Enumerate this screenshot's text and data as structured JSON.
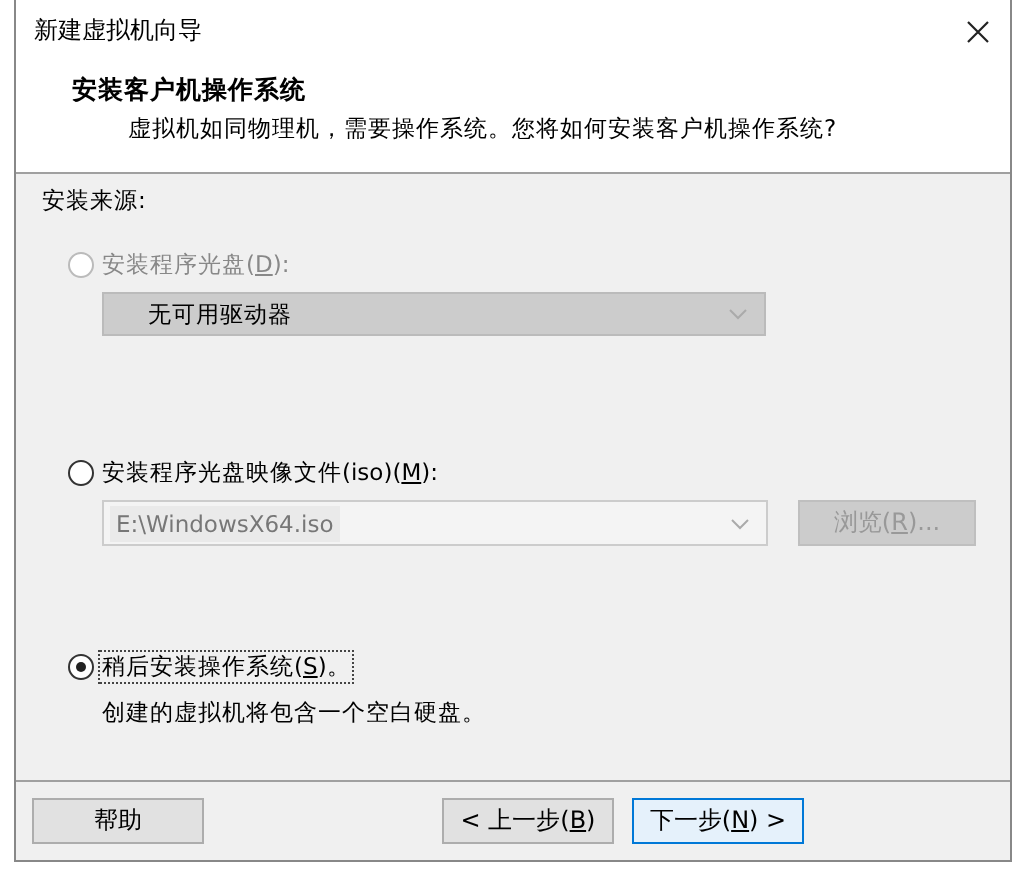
{
  "window": {
    "title": "新建虚拟机向导"
  },
  "header": {
    "title": "安装客户机操作系统",
    "subtitle": "虚拟机如同物理机，需要操作系统。您将如何安装客户机操作系统?"
  },
  "install_source": {
    "label": "安装来源:",
    "options": [
      {
        "kind": "drive",
        "before": "安装程序光盘(",
        "key": "D",
        "after": "):",
        "selected": false,
        "disabled": true,
        "focused": false,
        "select": {
          "value": "无可用驱动器",
          "disabled": true
        }
      },
      {
        "kind": "image",
        "before": "安装程序光盘映像文件(iso)(",
        "key": "M",
        "after": "):",
        "selected": false,
        "disabled": false,
        "focused": false,
        "combo": {
          "value": "E:\\WindowsX64.iso",
          "disabled": true
        },
        "browse": {
          "before": "浏览(",
          "key": "R",
          "after": ")...",
          "disabled": true
        }
      },
      {
        "kind": "later",
        "before": "稍后安装操作系统(",
        "key": "S",
        "after": ")。",
        "selected": true,
        "disabled": false,
        "focused": true,
        "description": "创建的虚拟机将包含一个空白硬盘。"
      }
    ]
  },
  "buttons": [
    {
      "kind": "help",
      "before": "帮助",
      "default": false
    },
    {
      "kind": "back",
      "before": "< 上一步(",
      "key": "B",
      "after": ")",
      "default": false
    },
    {
      "kind": "next",
      "before": "下一步(",
      "key": "N",
      "after": ") >",
      "default": true
    }
  ]
}
